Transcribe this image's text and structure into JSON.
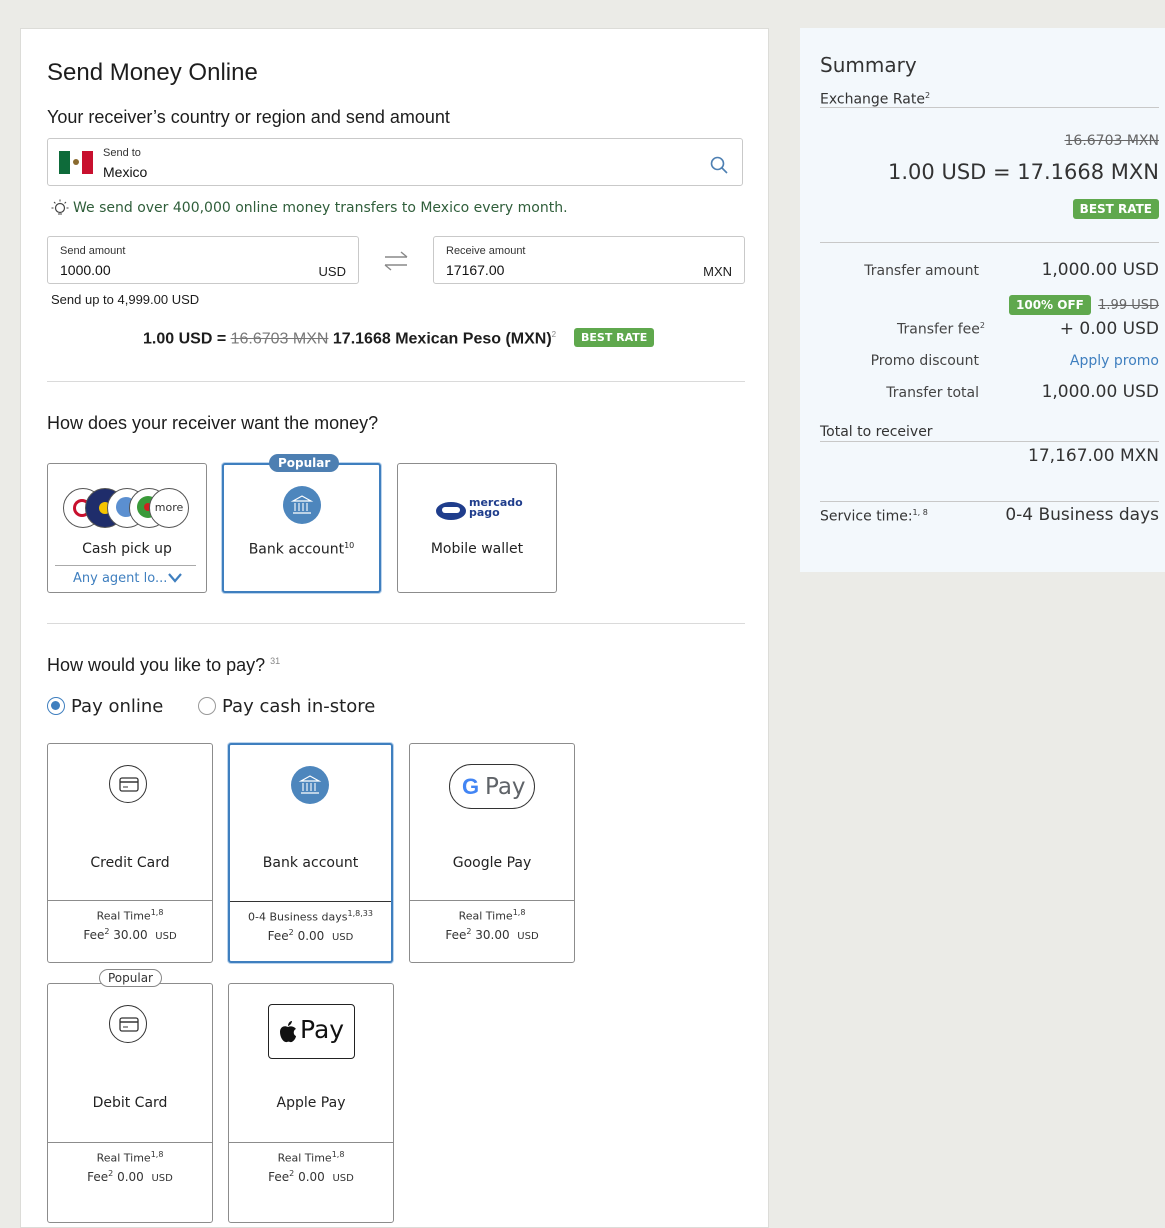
{
  "main": {
    "title": "Send Money Online",
    "receiver_heading": "Your receiver’s country or region and send amount",
    "send_to_label": "Send to",
    "send_to_value": "Mexico",
    "info_text": "We send over 400,000 online money transfers to Mexico every month.",
    "send_amount_label": "Send amount",
    "send_amount_value": "1000.00",
    "send_currency": "USD",
    "receive_amount_label": "Receive amount",
    "receive_amount_value": "17167.00",
    "receive_currency": "MXN",
    "send_limit": "Send up to 4,999.00 USD",
    "rate_prefix": "1.00 USD =",
    "rate_old": "16.6703 MXN",
    "rate_new": "17.1668 Mexican Peso (MXN)",
    "rate_sup": "2",
    "best_rate": "BEST RATE"
  },
  "receive": {
    "heading": "How does your receiver want the money?",
    "cash_pickup_label": "Cash pick up",
    "cash_more": "more",
    "cash_agent_select": "Any agent lo...",
    "popular_label": "Popular",
    "bank_label": "Bank account",
    "bank_sup": "10",
    "wallet_label": "Mobile wallet",
    "wallet_logo_line1": "mercado",
    "wallet_logo_line2": "pago"
  },
  "pay": {
    "heading": "How would you like to pay?",
    "heading_sup": "31",
    "option_online": "Pay online",
    "option_cash": "Pay cash in-store",
    "popular_label": "Popular",
    "methods": [
      {
        "label": "Credit Card",
        "speed": "Real Time",
        "speed_sup": "1,8",
        "fee_label": "Fee",
        "fee_sup": "2",
        "fee": "30.00",
        "currency": "USD"
      },
      {
        "label": "Bank account",
        "speed": "0-4 Business days",
        "speed_sup": "1,8,33",
        "fee_label": "Fee",
        "fee_sup": "2",
        "fee": "0.00",
        "currency": "USD"
      },
      {
        "label": "Google Pay",
        "speed": "Real Time",
        "speed_sup": "1,8",
        "fee_label": "Fee",
        "fee_sup": "2",
        "fee": "30.00",
        "currency": "USD"
      },
      {
        "label": "Debit Card",
        "speed": "Real Time",
        "speed_sup": "1,8",
        "fee_label": "Fee",
        "fee_sup": "2",
        "fee": "0.00",
        "currency": "USD"
      },
      {
        "label": "Apple Pay",
        "speed": "Real Time",
        "speed_sup": "1,8",
        "fee_label": "Fee",
        "fee_sup": "2",
        "fee": "0.00",
        "currency": "USD"
      }
    ],
    "gpay_text": "Pay",
    "applepay_text": "Pay"
  },
  "summary": {
    "title": "Summary",
    "exchange_rate_label": "Exchange Rate",
    "exchange_rate_sup": "2",
    "old_rate": "16.6703 MXN",
    "rate": "1.00 USD = 17.1668 MXN",
    "best_rate": "BEST RATE",
    "transfer_amount_label": "Transfer amount",
    "transfer_amount": "1,000.00 USD",
    "discount_badge": "100% OFF",
    "old_fee": "1.99 USD",
    "transfer_fee_label": "Transfer fee",
    "transfer_fee_sup": "2",
    "transfer_fee": "+ 0.00 USD",
    "promo_label": "Promo discount",
    "promo_link": "Apply promo",
    "total_label": "Transfer total",
    "total": "1,000.00 USD",
    "receiver_total_label": "Total  to receiver",
    "receiver_total": "17,167.00 MXN",
    "service_time_label": "Service time:",
    "service_time_sup": "1, 8",
    "service_time": "0-4 Business days"
  },
  "colors": {
    "accent_blue": "#3f7fbf",
    "best_rate_green": "#5fa84d",
    "summary_bg": "#f3f8fc",
    "page_bg": "#ebebe7"
  }
}
